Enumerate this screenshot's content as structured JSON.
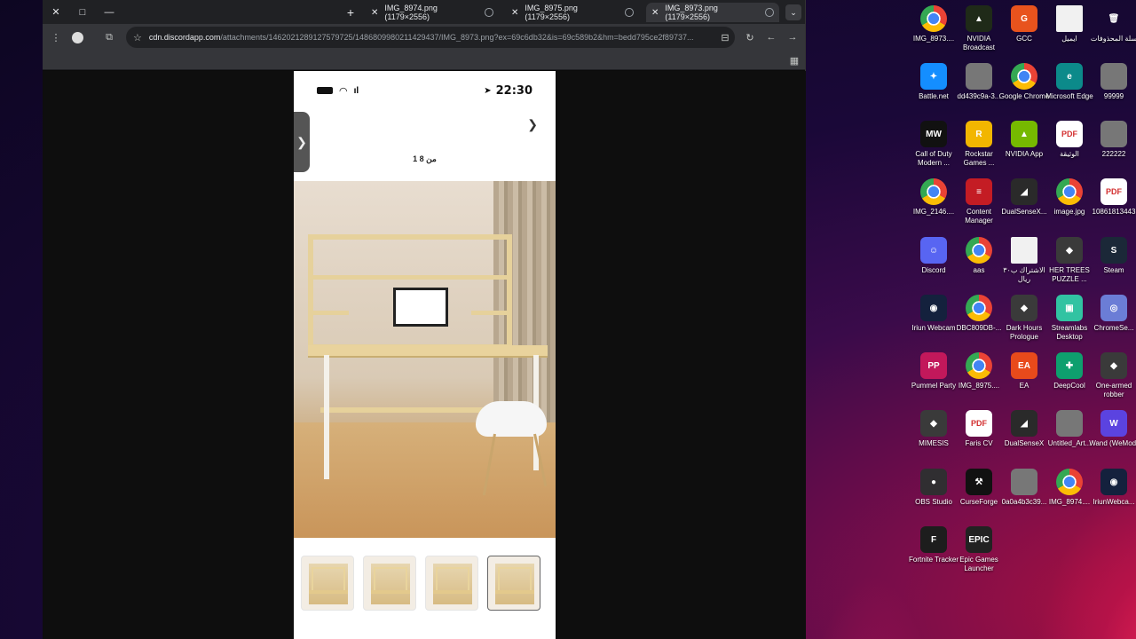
{
  "browser": {
    "tabs": [
      {
        "title": "IMG_8974.png (1179×2556)",
        "active": false
      },
      {
        "title": "IMG_8975.png (1179×2556)",
        "active": false
      },
      {
        "title": "IMG_8973.png (1179×2556)",
        "active": true
      }
    ],
    "url_host": "cdn.discordapp.com",
    "url_path": "/attachments/1462021289127579725/1486809980211429437/IMG_8973.png?ex=69c6db32&is=69c589b2&hm=bedd795ce2f89737..."
  },
  "phone": {
    "time": "22:30",
    "counter": "1 من 8",
    "thumbnails": [
      "thumb-1",
      "thumb-2",
      "thumb-3",
      "thumb-4"
    ],
    "selected_thumbnail": 4
  },
  "desktop_icons": [
    {
      "label": "IMG_8973....",
      "icon": "chrome-file-icon"
    },
    {
      "label": "NVIDIA Broadcast",
      "icon": "nvidia-broadcast-icon"
    },
    {
      "label": "GCC",
      "icon": "gcc-icon"
    },
    {
      "label": "ايميل",
      "icon": "text-file-icon"
    },
    {
      "label": "سلة المحذوفات",
      "icon": "recycle-bin-icon"
    },
    {
      "label": "Battle.net",
      "icon": "battlenet-icon"
    },
    {
      "label": "dd439c9a-3...",
      "icon": "image-file-icon"
    },
    {
      "label": "Google Chrome",
      "icon": "chrome-icon"
    },
    {
      "label": "Microsoft Edge",
      "icon": "edge-icon"
    },
    {
      "label": "99999",
      "icon": "image-file-icon"
    },
    {
      "label": "Call of Duty Modern ...",
      "icon": "cod-icon"
    },
    {
      "label": "Rockstar Games ...",
      "icon": "rockstar-icon"
    },
    {
      "label": "NVIDIA App",
      "icon": "nvidia-app-icon"
    },
    {
      "label": "الوثيقة",
      "icon": "pdf-icon"
    },
    {
      "label": "222222",
      "icon": "image-file-icon"
    },
    {
      "label": "IMG_2146....",
      "icon": "chrome-file-icon"
    },
    {
      "label": "Content Manager",
      "icon": "content-manager-icon"
    },
    {
      "label": "DualSenseX...",
      "icon": "dualsensex-icon"
    },
    {
      "label": "image.jpg",
      "icon": "chrome-file-icon"
    },
    {
      "label": "10861813443",
      "icon": "pdf-icon"
    },
    {
      "label": "Discord",
      "icon": "discord-icon"
    },
    {
      "label": "aas",
      "icon": "chrome-file-icon"
    },
    {
      "label": "الاشتراك ب٣٠ ريال",
      "icon": "text-file-icon"
    },
    {
      "label": "HER TREES PUZZLE ...",
      "icon": "game-icon"
    },
    {
      "label": "Steam",
      "icon": "steam-icon"
    },
    {
      "label": "Iriun Webcam",
      "icon": "iriun-icon"
    },
    {
      "label": "DBC809DB-...",
      "icon": "chrome-file-icon"
    },
    {
      "label": "Dark Hours Prologue",
      "icon": "game-icon"
    },
    {
      "label": "Streamlabs Desktop",
      "icon": "streamlabs-icon"
    },
    {
      "label": "ChromeSe...",
      "icon": "chrome-setup-icon"
    },
    {
      "label": "Pummel Party",
      "icon": "pummel-party-icon"
    },
    {
      "label": "IMG_8975....",
      "icon": "chrome-file-icon"
    },
    {
      "label": "EA",
      "icon": "ea-icon"
    },
    {
      "label": "DeepCool",
      "icon": "deepcool-icon"
    },
    {
      "label": "One-armed robber",
      "icon": "game-icon"
    },
    {
      "label": "MIMESIS",
      "icon": "game-icon"
    },
    {
      "label": "Faris CV",
      "icon": "pdf-icon"
    },
    {
      "label": "DualSenseX",
      "icon": "dualsensex-icon"
    },
    {
      "label": "Untitled_Art...",
      "icon": "image-file-icon"
    },
    {
      "label": "Wand (WeMod)",
      "icon": "wemod-icon"
    },
    {
      "label": "OBS Studio",
      "icon": "obs-icon"
    },
    {
      "label": "CurseForge",
      "icon": "curseforge-icon"
    },
    {
      "label": "0a0a4b3c39...",
      "icon": "image-file-icon"
    },
    {
      "label": "IMG_8974....",
      "icon": "chrome-file-icon"
    },
    {
      "label": "IriunWebca...",
      "icon": "iriun-icon"
    },
    {
      "label": "Fortnite Tracker",
      "icon": "fortnite-tracker-icon"
    },
    {
      "label": "Epic Games Launcher",
      "icon": "epic-games-icon"
    }
  ],
  "colors": {
    "chrome_dark": "#202124",
    "chrome_toolbar": "#35363a",
    "desk_wood": "#e6d19b"
  }
}
